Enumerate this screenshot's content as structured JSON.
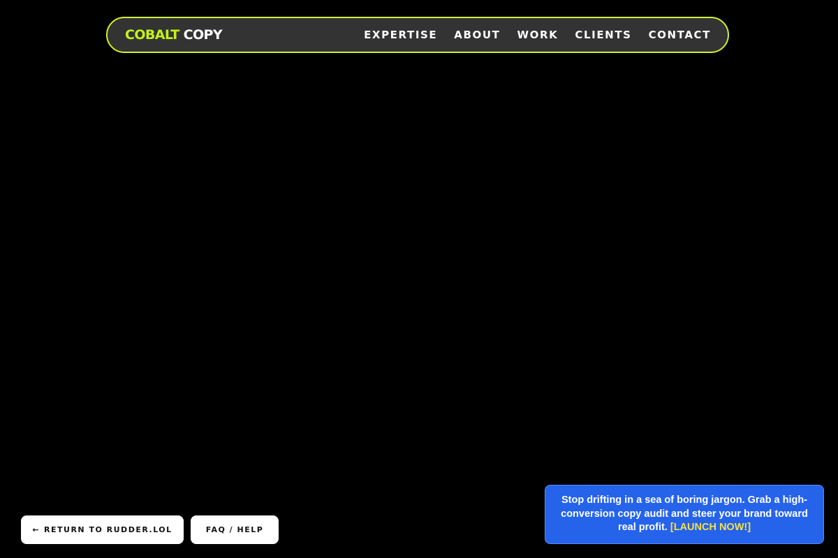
{
  "header": {
    "logo_accent": "COBALT",
    "logo_rest": "COPY",
    "nav": [
      {
        "label": "EXPERTISE"
      },
      {
        "label": "ABOUT"
      },
      {
        "label": "WORK"
      },
      {
        "label": "CLIENTS"
      },
      {
        "label": "CONTACT"
      }
    ]
  },
  "footer_buttons": {
    "return_arrow": "←",
    "return_label": "RETURN TO RUDDER.LOL",
    "faq_label": "FAQ / HELP"
  },
  "promo": {
    "message": "Stop drifting in a sea of boring jargon. Grab a high-conversion copy audit and steer your brand toward real profit.",
    "cta": "[LAUNCH NOW!]"
  },
  "colors": {
    "background": "#000000",
    "nav_background": "#333333",
    "nav_border": "#d4f02a",
    "logo_accent": "#c6f018",
    "promo_background": "#2563eb",
    "promo_cta": "#f5e04a"
  },
  "icons": {
    "return_arrow": "arrow-left-icon"
  }
}
